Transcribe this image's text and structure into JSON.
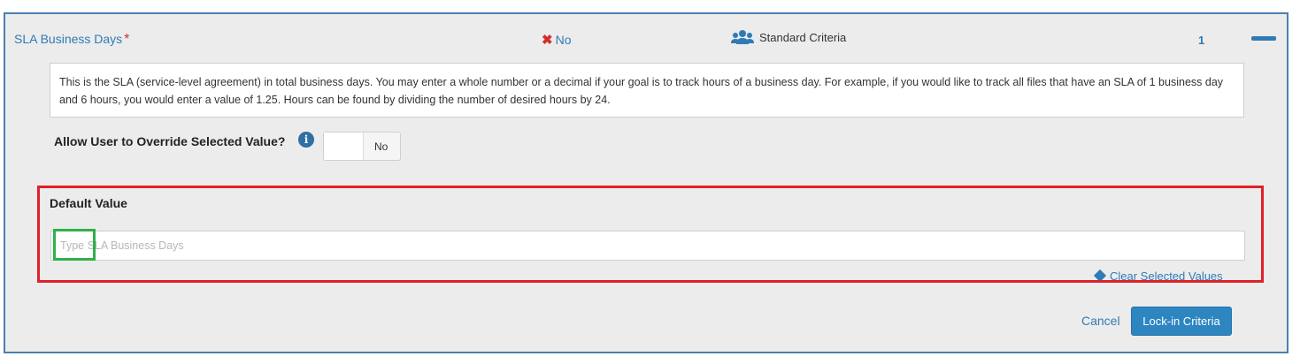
{
  "header": {
    "title": "SLA Business Days",
    "required_marker": "*",
    "status_icon": "x-icon",
    "status_text": "No",
    "criteria_icon": "users-icon",
    "criteria_label": "Standard Criteria",
    "count": "1",
    "collapse_icon": "minus-icon"
  },
  "description": "This is the SLA (service-level agreement) in total business days. You may enter a whole number or a decimal if your goal is to track hours of a business day. For example, if you would like to track all files that have an SLA of 1 business day and 6 hours, you would enter a value of 1.25. Hours can be found by dividing the number of desired hours by 24.",
  "override": {
    "label": "Allow User to Override Selected Value?",
    "info_icon": "info-icon",
    "toggle_value": "No"
  },
  "default_value": {
    "label": "Default Value",
    "placeholder": "Type SLA Business Days",
    "value": "",
    "clear_label": "Clear Selected Values"
  },
  "actions": {
    "cancel_label": "Cancel",
    "lockin_label": "Lock-in Criteria"
  },
  "colors": {
    "accent": "#2f7bb5",
    "required": "#d32f2f",
    "highlight_red": "#e0202a",
    "highlight_green": "#2fb04a",
    "button_bg": "#2e86c1"
  }
}
